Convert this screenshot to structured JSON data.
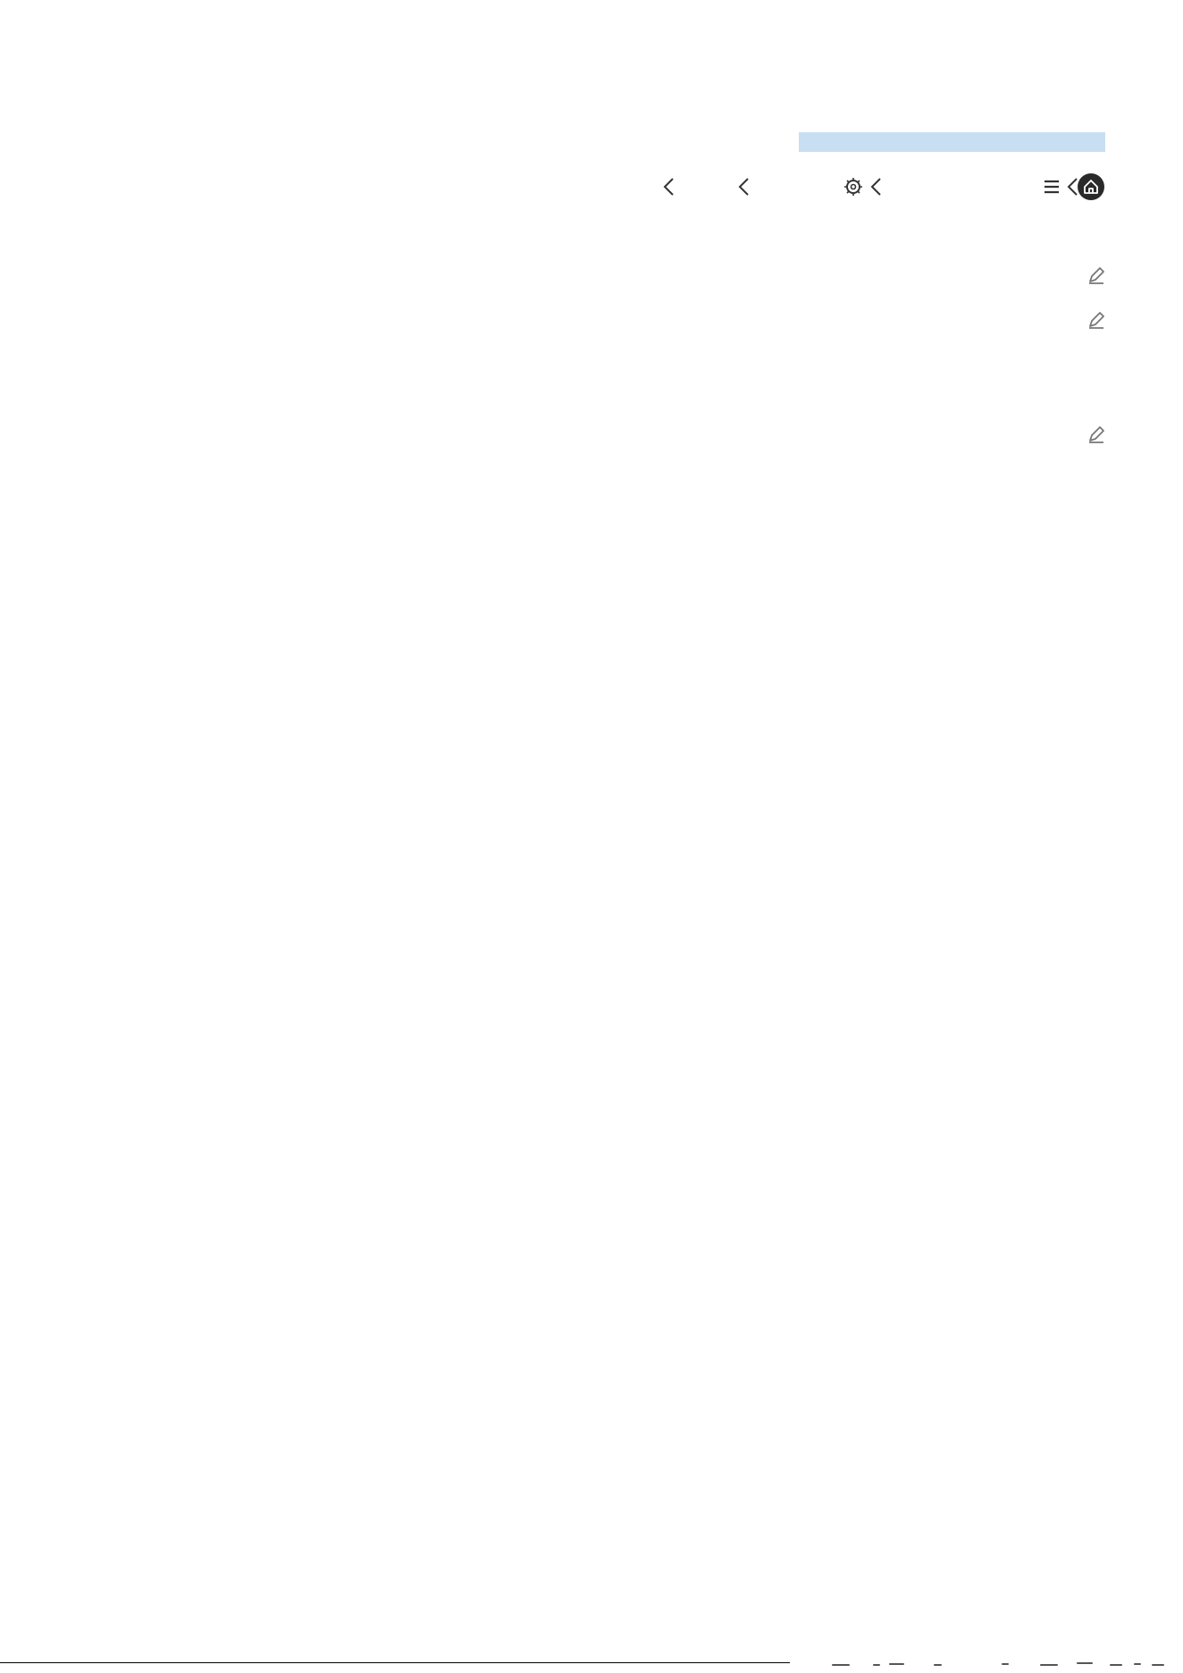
{
  "document": {
    "section_band_color": "#c8dff3",
    "navigation_icons": [
      "chevron-left-icon",
      "chevron-left-icon",
      "settings-icon",
      "chevron-left-icon",
      "menu-icon",
      "chevron-left-icon",
      "home-icon"
    ],
    "edit_icons": [
      "edit-icon",
      "edit-icon",
      "edit-icon"
    ],
    "accent_color": "#2a2a2a"
  }
}
